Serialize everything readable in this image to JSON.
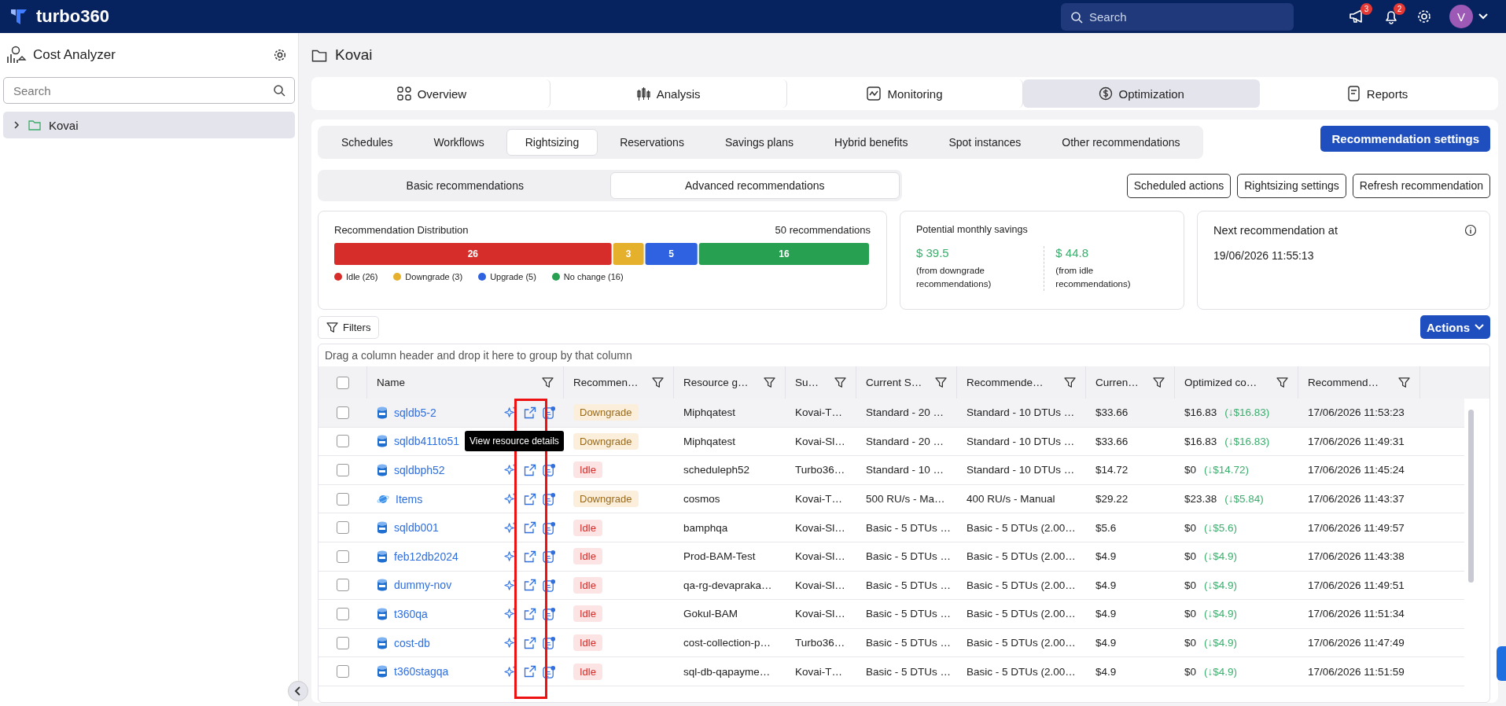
{
  "top_bar": {
    "logo": "turbo360",
    "search": {
      "placeholder": "Search"
    },
    "badges": [
      {
        "count": "3"
      },
      {
        "count": "2"
      }
    ],
    "avatar": "V"
  },
  "sidebar": {
    "title": "Cost Analyzer",
    "search": {
      "placeholder": "Search"
    },
    "tree": [
      {
        "label": "Kovai",
        "expanded": false,
        "selected": true
      }
    ]
  },
  "page": {
    "title": "Kovai"
  },
  "nav_tabs": [
    {
      "label": "Overview",
      "selected": false
    },
    {
      "label": "Analysis",
      "selected": false
    },
    {
      "label": "Monitoring",
      "selected": false
    },
    {
      "label": "Optimization",
      "selected": true
    },
    {
      "label": "Reports",
      "selected": false
    }
  ],
  "sub_tabs": [
    {
      "label": "Schedules",
      "selected": false
    },
    {
      "label": "Workflows",
      "selected": false
    },
    {
      "label": "Rightsizing",
      "selected": true
    },
    {
      "label": "Reservations",
      "selected": false
    },
    {
      "label": "Savings plans",
      "selected": false
    },
    {
      "label": "Hybrid benefits",
      "selected": false
    },
    {
      "label": "Spot instances",
      "selected": false
    },
    {
      "label": "Other recommendations",
      "selected": false
    }
  ],
  "primary_button": "Recommendation settings",
  "modes": [
    {
      "label": "Basic recommendations",
      "selected": false
    },
    {
      "label": "Advanced recommendations",
      "selected": true
    }
  ],
  "action_buttons": [
    "Scheduled actions",
    "Rightsizing settings",
    "Refresh recommendation"
  ],
  "distribution": {
    "title": "Recommendation Distribution",
    "total": "50 recommendations",
    "chart_data": {
      "type": "bar",
      "orientation": "horizontal",
      "stacked": true,
      "data_labels": true,
      "series": [
        {
          "name": "Idle (26)",
          "color": "#d62d2a",
          "values": [
            26
          ]
        },
        {
          "name": "Downgrade (3)",
          "color": "#e5b02c",
          "values": [
            3
          ]
        },
        {
          "name": "Upgrade (5)",
          "color": "#2f62e0",
          "values": [
            5
          ]
        },
        {
          "name": "No change (16)",
          "color": "#27a151",
          "values": [
            16
          ]
        }
      ]
    }
  },
  "savings": {
    "title": "Potential monthly savings",
    "items": [
      {
        "amount": "$ 39.5",
        "note": "(from downgrade recommendations)"
      },
      {
        "amount": "$ 44.8",
        "note": "(from idle recommendations)"
      }
    ]
  },
  "next_run": {
    "title": "Next recommendation at",
    "value": "19/06/2026 11:55:13"
  },
  "filters_button": "Filters",
  "actions_button": "Actions",
  "table": {
    "group_hint": "Drag a column header and drop it here to group by that column",
    "select_all": {
      "checked": false
    },
    "columns": [
      "Name",
      "Recommen…",
      "Resource g…",
      "Su…",
      "Current S…",
      "Recommende…",
      "Curren…",
      "Optimized co…",
      "Recommend…"
    ],
    "rows": [
      {
        "name": "sqldb5-2",
        "kind": "sql",
        "checked": false,
        "highlighted": true,
        "recommendation": {
          "label": "Downgrade",
          "kind": "downgrade"
        },
        "resource_group": "Miphqatest",
        "subscription": "Kovai-T…",
        "current_sku": "Standard - 20 …",
        "recommended_sku": "Standard - 10 DTUs …",
        "current_cost": "$33.66",
        "optimized_cost": "$16.83",
        "saving": "(↓$16.83)",
        "recommended_at": "17/06/2026 11:53:23"
      },
      {
        "name": "sqldb411to51",
        "kind": "sql",
        "checked": false,
        "highlighted": false,
        "recommendation": {
          "label": "Downgrade",
          "kind": "downgrade"
        },
        "resource_group": "Miphqatest",
        "subscription": "Kovai-Sl…",
        "current_sku": "Standard - 20 …",
        "recommended_sku": "Standard - 10 DTUs …",
        "current_cost": "$33.66",
        "optimized_cost": "$16.83",
        "saving": "(↓$16.83)",
        "recommended_at": "17/06/2026 11:49:31",
        "tooltip": "View resource details"
      },
      {
        "name": "sqldbph52",
        "kind": "sql",
        "checked": false,
        "highlighted": false,
        "recommendation": {
          "label": "Idle",
          "kind": "idle"
        },
        "resource_group": "scheduleph52",
        "subscription": "Turbo36…",
        "current_sku": "Standard - 10 …",
        "recommended_sku": "Standard - 10 DTUs …",
        "current_cost": "$14.72",
        "optimized_cost": "$0",
        "saving": "(↓$14.72)",
        "recommended_at": "17/06/2026 11:45:24"
      },
      {
        "name": "Items",
        "kind": "cosmos",
        "checked": false,
        "highlighted": false,
        "recommendation": {
          "label": "Downgrade",
          "kind": "downgrade"
        },
        "resource_group": "cosmos",
        "subscription": "Kovai-T…",
        "current_sku": "500 RU/s - Ma…",
        "recommended_sku": "400 RU/s - Manual",
        "current_cost": "$29.22",
        "optimized_cost": "$23.38",
        "saving": "(↓$5.84)",
        "recommended_at": "17/06/2026 11:43:37"
      },
      {
        "name": "sqldb001",
        "kind": "sql",
        "checked": false,
        "highlighted": false,
        "recommendation": {
          "label": "Idle",
          "kind": "idle"
        },
        "resource_group": "bamphqa",
        "subscription": "Kovai-Sl…",
        "current_sku": "Basic - 5 DTUs …",
        "recommended_sku": "Basic - 5 DTUs (2.00…",
        "current_cost": "$5.6",
        "optimized_cost": "$0",
        "saving": "(↓$5.6)",
        "recommended_at": "17/06/2026 11:49:57"
      },
      {
        "name": "feb12db2024",
        "kind": "sql",
        "checked": false,
        "highlighted": false,
        "recommendation": {
          "label": "Idle",
          "kind": "idle"
        },
        "resource_group": "Prod-BAM-Test",
        "subscription": "Kovai-Sl…",
        "current_sku": "Basic - 5 DTUs …",
        "recommended_sku": "Basic - 5 DTUs (2.00…",
        "current_cost": "$4.9",
        "optimized_cost": "$0",
        "saving": "(↓$4.9)",
        "recommended_at": "17/06/2026 11:43:38"
      },
      {
        "name": "dummy-nov",
        "kind": "sql",
        "checked": false,
        "highlighted": false,
        "recommendation": {
          "label": "Idle",
          "kind": "idle"
        },
        "resource_group": "qa-rg-devapraka…",
        "subscription": "Kovai-Sl…",
        "current_sku": "Basic - 5 DTUs …",
        "recommended_sku": "Basic - 5 DTUs (2.00…",
        "current_cost": "$4.9",
        "optimized_cost": "$0",
        "saving": "(↓$4.9)",
        "recommended_at": "17/06/2026 11:49:51"
      },
      {
        "name": "t360qa",
        "kind": "sql",
        "checked": false,
        "highlighted": false,
        "recommendation": {
          "label": "Idle",
          "kind": "idle"
        },
        "resource_group": "Gokul-BAM",
        "subscription": "Kovai-Sl…",
        "current_sku": "Basic - 5 DTUs …",
        "recommended_sku": "Basic - 5 DTUs (2.00…",
        "current_cost": "$4.9",
        "optimized_cost": "$0",
        "saving": "(↓$4.9)",
        "recommended_at": "17/06/2026 11:51:34"
      },
      {
        "name": "cost-db",
        "kind": "sql",
        "checked": false,
        "highlighted": false,
        "recommendation": {
          "label": "Idle",
          "kind": "idle"
        },
        "resource_group": "cost-collection-p…",
        "subscription": "Turbo36…",
        "current_sku": "Basic - 5 DTUs …",
        "recommended_sku": "Basic - 5 DTUs (2.00…",
        "current_cost": "$4.9",
        "optimized_cost": "$0",
        "saving": "(↓$4.9)",
        "recommended_at": "17/06/2026 11:47:49"
      },
      {
        "name": "t360stagqa",
        "kind": "sql",
        "checked": false,
        "highlighted": false,
        "recommendation": {
          "label": "Idle",
          "kind": "idle"
        },
        "resource_group": "sql-db-qapayme…",
        "subscription": "Kovai-T…",
        "current_sku": "Basic - 5 DTUs …",
        "recommended_sku": "Basic - 5 DTUs (2.00…",
        "current_cost": "$4.9",
        "optimized_cost": "$0",
        "saving": "(↓$4.9)",
        "recommended_at": "17/06/2026 11:51:59"
      }
    ]
  }
}
